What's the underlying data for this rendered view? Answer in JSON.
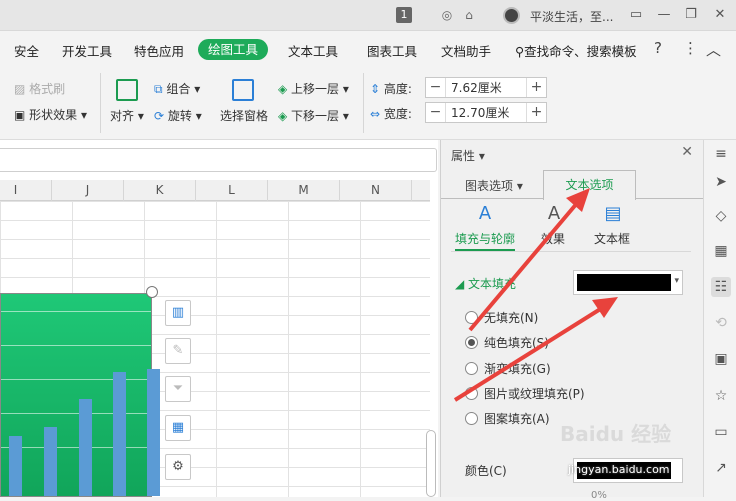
{
  "titlebar": {
    "badge": "1",
    "user": "平淡生活，至..."
  },
  "menu": {
    "items": [
      "安全",
      "开发工具",
      "特色应用",
      "绘图工具",
      "文本工具",
      "图表工具",
      "文档助手"
    ],
    "active": "绘图工具",
    "search": "查找命令、搜索模板"
  },
  "ribbon": {
    "format_brush": "格式刷",
    "shape_effect": "形状效果",
    "align": "对齐",
    "group": "组合",
    "rotate": "旋转",
    "selection_pane": "选择窗格",
    "bring_forward": "上移一层",
    "send_backward": "下移一层",
    "height_label": "高度:",
    "height_value": "7.62厘米",
    "width_label": "宽度:",
    "width_value": "12.70厘米"
  },
  "sheet": {
    "columns": [
      "I",
      "J",
      "K",
      "L",
      "M",
      "N"
    ]
  },
  "chart_data": {
    "type": "bar",
    "values": [
      32,
      37,
      52,
      66,
      68
    ],
    "ylim": [
      0,
      80
    ],
    "grid": true
  },
  "panel": {
    "title": "属性",
    "tab_chart": "图表选项",
    "tab_text": "文本选项",
    "sub_fill": "填充与轮廓",
    "sub_effect": "效果",
    "sub_textbox": "文本框",
    "section": "文本填充",
    "fill_color": "#000000",
    "options": [
      "无填充(N)",
      "纯色填充(S)",
      "渐变填充(G)",
      "图片或纹理填充(P)",
      "图案填充(A)"
    ],
    "selected": "纯色填充(S)",
    "color_label": "颜色(C)",
    "percent": "0%"
  },
  "watermark": {
    "brand": "Baidu 经验",
    "url": "jingyan.baidu.com"
  }
}
